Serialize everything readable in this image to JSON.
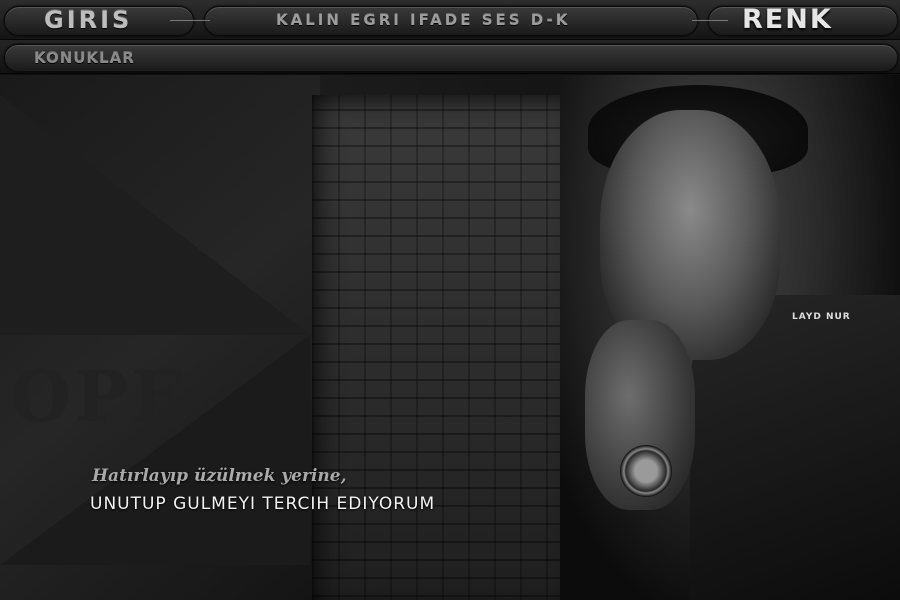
{
  "nav": {
    "giris": "GIRIS",
    "menu": "KALIN EGRI IFADE SES D-K",
    "renk": "RENK",
    "konuklar": "KONUKLAR"
  },
  "watermark": "LAYD NUR",
  "quote": {
    "line1": "Hatırlayıp üzülmek yerine,",
    "line2": "UNUTUP GULMEYI TERCIH EDIYORUM"
  },
  "colors": {
    "background": "#111111",
    "bar": "#2d2d2d",
    "accent_text": "#e6e6e6"
  }
}
